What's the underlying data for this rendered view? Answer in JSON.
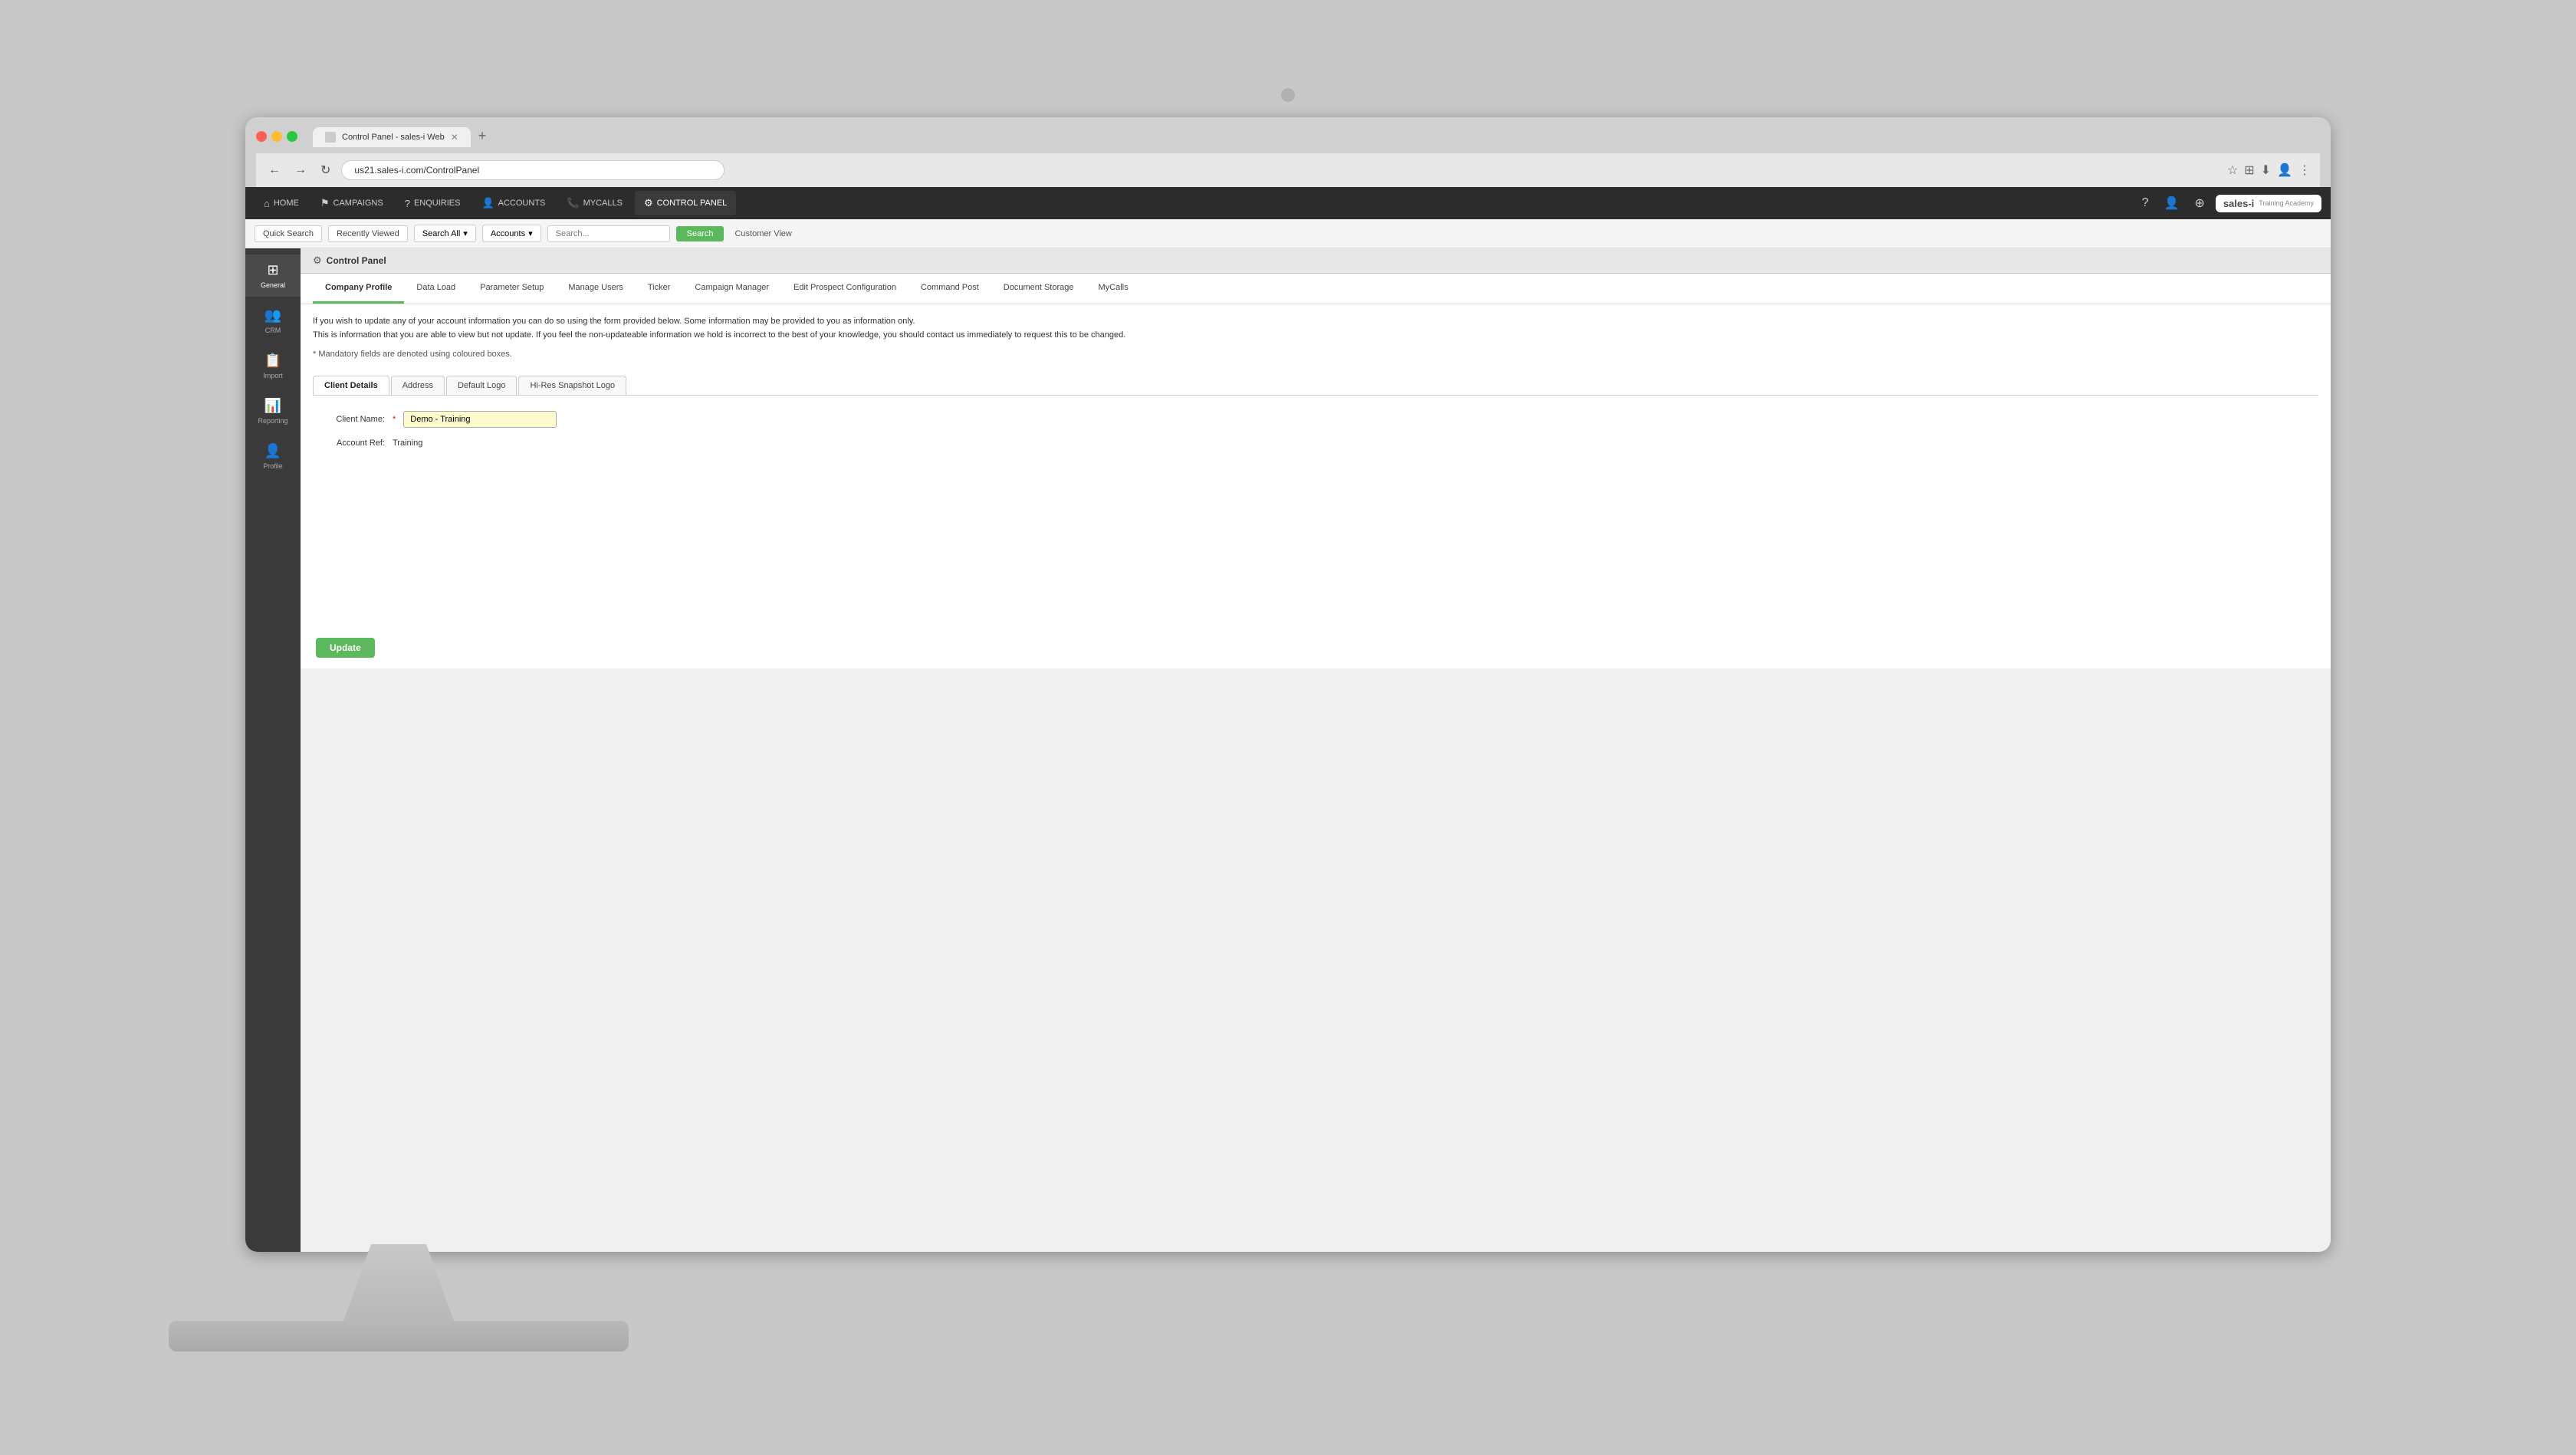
{
  "monitor": {
    "camera_label": "camera"
  },
  "browser": {
    "tab_title": "Control Panel - sales-i Web",
    "tab_favicon": "tab",
    "address": "us21.sales-i.com/ControlPanel",
    "new_tab_label": "+"
  },
  "top_nav": {
    "items": [
      {
        "id": "home",
        "label": "HOME",
        "icon": "⌂"
      },
      {
        "id": "campaigns",
        "label": "CAMPAIGNS",
        "icon": "⚑"
      },
      {
        "id": "enquiries",
        "label": "ENQUIRIES",
        "icon": "?"
      },
      {
        "id": "accounts",
        "label": "ACCOUNTS",
        "icon": "👤"
      },
      {
        "id": "mycalls",
        "label": "MYCALLS",
        "icon": "📞"
      },
      {
        "id": "controlpanel",
        "label": "CONTROL PANEL",
        "icon": "⚙"
      }
    ],
    "icons": {
      "help": "?",
      "user": "👤",
      "settings": "⚙"
    }
  },
  "logo": {
    "brand": "sales-i",
    "sub": "Training Academy"
  },
  "search_bar": {
    "quick_search": "Quick Search",
    "recently_viewed": "Recently Viewed",
    "search_all_label": "Search All",
    "accounts_label": "Accounts",
    "search_placeholder": "Search...",
    "search_btn": "Search",
    "customer_view": "Customer View"
  },
  "sidebar": {
    "items": [
      {
        "id": "general",
        "label": "General",
        "icon": "⊞"
      },
      {
        "id": "crm",
        "label": "CRM",
        "icon": "👥"
      },
      {
        "id": "import",
        "label": "Import",
        "icon": "📋"
      },
      {
        "id": "reporting",
        "label": "Reporting",
        "icon": "📊"
      },
      {
        "id": "profile",
        "label": "Profile",
        "icon": "👤"
      }
    ]
  },
  "breadcrumb": {
    "icon": "⚙",
    "label": "Control Panel"
  },
  "control_panel_tabs": [
    {
      "id": "company_profile",
      "label": "Company Profile",
      "active": true
    },
    {
      "id": "data_load",
      "label": "Data Load"
    },
    {
      "id": "parameter_setup",
      "label": "Parameter Setup"
    },
    {
      "id": "manage_users",
      "label": "Manage Users"
    },
    {
      "id": "ticker",
      "label": "Ticker"
    },
    {
      "id": "campaign_manager",
      "label": "Campaign Manager"
    },
    {
      "id": "edit_prospect_configuration",
      "label": "Edit Prospect Configuration"
    },
    {
      "id": "command_post",
      "label": "Command Post"
    },
    {
      "id": "document_storage",
      "label": "Document Storage"
    },
    {
      "id": "mycalls",
      "label": "MyCalls"
    }
  ],
  "description": {
    "line1": "If you wish to update any of your account information you can do so using the form provided below. Some information may be provided to you as information only.",
    "line2": "This is information that you are able to view but not update. If you feel the non-updateable information we hold is incorrect to the best of your knowledge, you should contact us immediately to request this to be changed.",
    "mandatory_note": "* Mandatory fields are denoted using coloured boxes."
  },
  "form_tabs": [
    {
      "id": "client_details",
      "label": "Client Details",
      "active": true
    },
    {
      "id": "address",
      "label": "Address"
    },
    {
      "id": "default_logo",
      "label": "Default Logo"
    },
    {
      "id": "hi_res_snapshot_logo",
      "label": "Hi-Res Snapshot Logo"
    }
  ],
  "form_fields": {
    "client_name_label": "Client Name:",
    "client_name_required": "*",
    "client_name_value": "Demo - Training",
    "account_ref_label": "Account Ref:",
    "account_ref_value": "Training"
  },
  "update_button": {
    "label": "Update"
  }
}
